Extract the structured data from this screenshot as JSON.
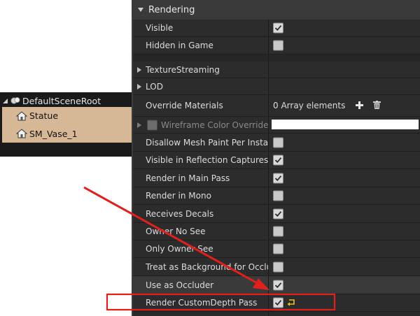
{
  "outliner": {
    "root_label": "DefaultSceneRoot",
    "children": [
      {
        "label": "Statue"
      },
      {
        "label": "SM_Vase_1"
      }
    ]
  },
  "details": {
    "category_title": "Rendering",
    "rows": {
      "visible": {
        "label": "Visible",
        "checked": true
      },
      "hidden_in_game": {
        "label": "Hidden in Game",
        "checked": false
      },
      "texture_streaming": {
        "label": "TextureStreaming"
      },
      "lod": {
        "label": "LOD"
      },
      "override_materials": {
        "label": "Override Materials",
        "value": "0 Array elements"
      },
      "wireframe": {
        "label": "Wireframe Color Override"
      },
      "disallow_mesh_paint": {
        "label": "Disallow Mesh Paint Per Instance",
        "checked": false
      },
      "visible_in_reflection": {
        "label": "Visible in Reflection Captures",
        "checked": true
      },
      "render_main_pass": {
        "label": "Render in Main Pass",
        "checked": true
      },
      "render_in_mono": {
        "label": "Render in Mono",
        "checked": false
      },
      "receives_decals": {
        "label": "Receives Decals",
        "checked": true
      },
      "owner_no_see": {
        "label": "Owner No See",
        "checked": false
      },
      "only_owner_see": {
        "label": "Only Owner See",
        "checked": false
      },
      "treat_as_background": {
        "label": "Treat as Background for Occlusion",
        "checked": false
      },
      "use_as_occluder": {
        "label": "Use as Occluder",
        "checked": true
      },
      "render_custom_depth": {
        "label": "Render CustomDepth Pass",
        "checked": true
      }
    }
  },
  "colors": {
    "annotation_red": "#e0201c",
    "outliner_selection": "#d6b896",
    "panel_bg": "#242424"
  },
  "icons": {
    "tree_expand": "triangle-down-right",
    "root": "scene-root-icon",
    "actor": "house-actor-icon",
    "add": "plus-icon",
    "delete": "trash-icon",
    "reset": "reset-to-default-icon"
  }
}
